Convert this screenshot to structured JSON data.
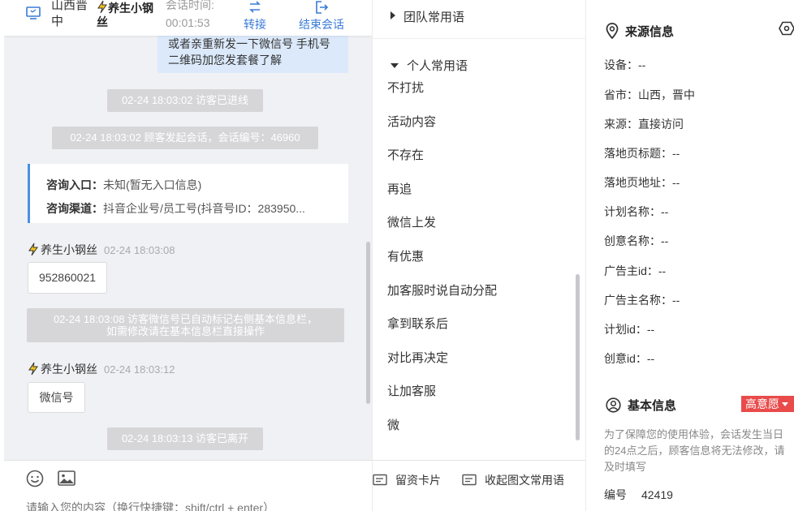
{
  "header": {
    "location": "山西晋中",
    "visitor_name": "养生小钢丝",
    "session_time_label": "会话时间:",
    "session_time": "00:01:53",
    "transfer_label": "转接",
    "end_label": "结束会话"
  },
  "chat": {
    "outgoing_text": "或者亲重新发一下微信号 手机号二维码加您发套餐了解",
    "sys_entered": "02-24 18:03:02 访客已进线",
    "sys_started": "02-24 18:03:02 顾客发起会话，会话编号：46960",
    "consult_entry_label": "咨询入口：",
    "consult_entry_value": "未知(暂无入口信息)",
    "consult_channel_label": "咨询渠道：",
    "consult_channel_value": "抖音企业号/员工号(抖音号ID：283950...",
    "msg1_sender": "养生小钢丝",
    "msg1_time": "02-24 18:03:08",
    "msg1_text": "952860021",
    "sys_wechat_line1": "02-24 18:03:08 访客微信号已自动标记右侧基本信息栏，",
    "sys_wechat_line2": "如需修改请在基本信息栏直接操作",
    "msg2_sender": "养生小钢丝",
    "msg2_time": "02-24 18:03:12",
    "msg2_text": "微信号",
    "sys_left": "02-24 18:03:13 访客已离开",
    "input_placeholder": "请输入您的内容（换行快捷键：shift/ctrl + enter）"
  },
  "phrases": {
    "team_group": "团队常用语",
    "personal_group": "个人常用语",
    "items": [
      "不打扰",
      "活动内容",
      "不存在",
      "再追",
      "微信上发",
      "有优惠",
      "加客服时说自动分配",
      "拿到联系后",
      "对比再决定",
      "让加客服",
      "微"
    ],
    "card_button": "留资卡片",
    "collapse_button": "收起图文常用语"
  },
  "info": {
    "source_title": "来源信息",
    "source_fields": [
      "设备：--",
      "省市：山西，晋中",
      "来源：直接访问",
      "落地页标题：--",
      "落地页地址：--",
      "计划名称：--",
      "创意名称：--",
      "广告主id：--",
      "广告主名称：--",
      "计划id：--",
      "创意id：--"
    ],
    "basic_title": "基本信息",
    "intent_badge": "高意愿",
    "notice": "为了保障您的使用体验，会话发生当日的24点之后，顾客信息将无法修改，请及时填写",
    "number_label": "编号",
    "number_value": "42419"
  },
  "colors": {
    "accent": "#3a7bd5",
    "badge": "#e94b4b",
    "system_msg": "#d6d6d8",
    "outgoing_bubble": "#dbe9fb"
  }
}
